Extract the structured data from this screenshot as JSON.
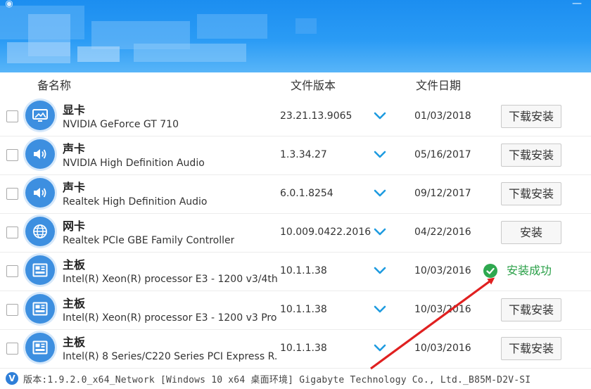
{
  "window": {
    "logo_glyph": "◉",
    "close_glyph": "—"
  },
  "columns": {
    "device": "备名称",
    "version": "文件版本",
    "date": "文件日期"
  },
  "devices": [
    {
      "name": "显卡",
      "desc": "NVIDIA GeForce GT 710",
      "version": "23.21.13.9065",
      "date": "01/03/2018",
      "action": "下载安装",
      "icon": "display-icon",
      "checked": false
    },
    {
      "name": "声卡",
      "desc": "NVIDIA High Definition Audio",
      "version": "1.3.34.27",
      "date": "05/16/2017",
      "action": "下载安装",
      "icon": "speaker-icon",
      "checked": false
    },
    {
      "name": "声卡",
      "desc": "Realtek High Definition Audio",
      "version": "6.0.1.8254",
      "date": "09/12/2017",
      "action": "下载安装",
      "icon": "speaker-icon",
      "checked": false
    },
    {
      "name": "网卡",
      "desc": "Realtek PCIe GBE Family Controller",
      "version": "10.009.0422.2016",
      "date": "04/22/2016",
      "action": "安装",
      "icon": "globe-icon",
      "checked": false
    },
    {
      "name": "主板",
      "desc": "Intel(R) Xeon(R) processor E3 - 1200 v3/4th...",
      "version": "10.1.1.38",
      "date": "10/03/2016",
      "action": "安装成功",
      "icon": "motherboard-icon",
      "checked": false
    },
    {
      "name": "主板",
      "desc": "Intel(R) Xeon(R) processor E3 - 1200 v3 Pro...",
      "version": "10.1.1.38",
      "date": "10/03/2016",
      "action": "下载安装",
      "icon": "motherboard-icon",
      "checked": false
    },
    {
      "name": "主板",
      "desc": "Intel(R) 8 Series/C220 Series PCI Express R...",
      "version": "10.1.1.38",
      "date": "10/03/2016",
      "action": "下载安装",
      "icon": "motherboard-icon",
      "checked": false
    }
  ],
  "footer": {
    "logo_glyph": "V",
    "text": "版本:1.9.2.0_x64_Network [Windows 10 x64 桌面环境] Gigabyte Technology Co., Ltd._B85M-D2V-SI"
  },
  "colors": {
    "header": "#2a9bf5",
    "accent": "#3d8fe0",
    "success": "#2aa048",
    "arrow": "#e02020"
  }
}
